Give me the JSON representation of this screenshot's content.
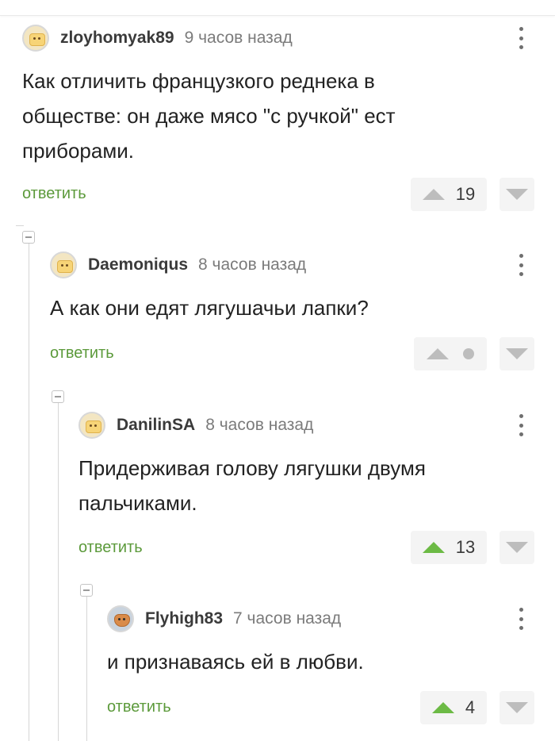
{
  "comments": [
    {
      "author": "zloyhomyak89",
      "time": "9 часов назад",
      "lines": [
        "Как отличить французкого реднека в",
        "обществе: он даже мясо \"с ручкой\" ест",
        "приборами."
      ],
      "reply_label": "ответить",
      "score": "19",
      "upvoted": false
    },
    {
      "author": "Daemoniqus",
      "time": "8 часов назад",
      "lines": [
        "А как они едят лягушачьи лапки?"
      ],
      "reply_label": "ответить",
      "score": "",
      "upvoted": false
    },
    {
      "author": "DanilinSA",
      "time": "8 часов назад",
      "lines": [
        "Придерживая голову лягушки двумя",
        "пальчиками."
      ],
      "reply_label": "ответить",
      "score": "13",
      "upvoted": true
    },
    {
      "author": "Flyhigh83",
      "time": "7 часов назад",
      "lines": [
        "и признаваясь ей в любви."
      ],
      "reply_label": "ответить",
      "score": "4",
      "upvoted": true
    }
  ],
  "colors": {
    "accent_green": "#6cba45",
    "reply_green": "#5c9a3b",
    "vote_bg": "#f4f4f4",
    "arrow_gray": "#bdbdbd"
  },
  "icons": [
    "more-vertical-icon",
    "upvote-arrow-icon",
    "downvote-arrow-icon",
    "collapse-minus-icon",
    "user-avatar"
  ]
}
